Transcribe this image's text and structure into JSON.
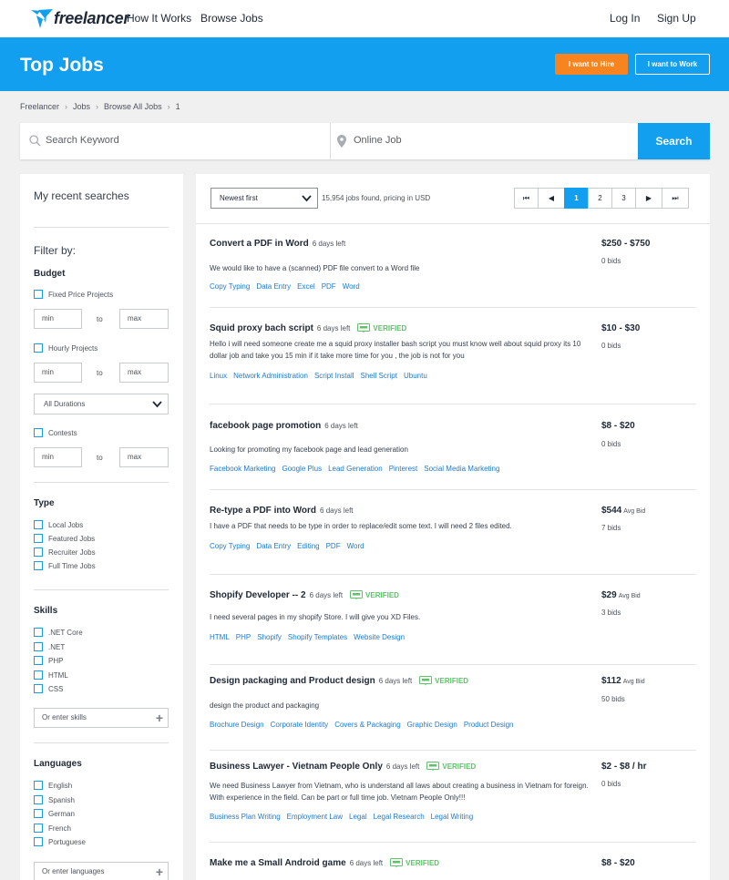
{
  "nav": {
    "logo_text": "freelancer",
    "links": [
      "How It Works",
      "Browse Jobs"
    ],
    "login": "Log In",
    "signup": "Sign Up"
  },
  "hero": {
    "title": "Top Jobs",
    "hire_button": "I want to Hire",
    "work_button": "I want to Work"
  },
  "breadcrumb": [
    "Freelancer",
    "Jobs",
    "Browse All Jobs",
    "1"
  ],
  "search": {
    "keyword_placeholder": "Search Keyword",
    "location_value": "Online Job",
    "button": "Search"
  },
  "sidebar": {
    "recent_searches": "My recent searches",
    "filter_by": "Filter by:",
    "budget": {
      "label": "Budget",
      "fixed": "Fixed Price Projects",
      "hourly": "Hourly Projects",
      "min": "min",
      "to": "to",
      "max": "max",
      "durations": "All Durations",
      "contests": "Contests"
    },
    "type": {
      "label": "Type",
      "items": [
        "Local Jobs",
        "Featured Jobs",
        "Recruiter Jobs",
        "Full Time Jobs"
      ]
    },
    "skills": {
      "label": "Skills",
      "items": [
        ".NET Core",
        ".NET",
        "PHP",
        "HTML",
        "CSS"
      ],
      "enter": "Or enter skills"
    },
    "languages": {
      "label": "Languages",
      "items": [
        "English",
        "Spanish",
        "German",
        "French",
        "Portuguese"
      ],
      "enter": "Or enter languages"
    }
  },
  "results": {
    "sort": "Newest first",
    "count": "15,954 jobs found, pricing in USD",
    "pages": [
      "1",
      "2",
      "3"
    ],
    "active_page": "1",
    "verified_label": "VERIFIED",
    "jobs": [
      {
        "title": "Convert a PDF in Word",
        "days": "6 days left",
        "verified": false,
        "desc": "We would like to have a (scanned) PDF file convert to a Word file",
        "skills": [
          "Copy Typing",
          "Data Entry",
          "Excel",
          "PDF",
          "Word"
        ],
        "price": "$250 - $750",
        "price_note": "",
        "bids": "0 bids"
      },
      {
        "title": "Squid proxy bach script",
        "days": "6 days left",
        "verified": true,
        "desc": "Hello i will need someone create me a squid proxy installer bash script you must know well about squid proxy its 10 dollar job and take you 15 min if it take more time for you , the job is not for you",
        "skills": [
          "Linux",
          "Network Administration",
          "Script Install",
          "Shell Script",
          "Ubuntu"
        ],
        "price": "$10 - $30",
        "price_note": "",
        "bids": "0 bids"
      },
      {
        "title": "facebook page promotion",
        "days": "6 days left",
        "verified": false,
        "desc": "Looking for promoting my facebook page and lead generation",
        "skills": [
          "Facebook Marketing",
          "Google Plus",
          "Lead Generation",
          "Pinterest",
          "Social Media Marketing"
        ],
        "price": "$8 - $20",
        "price_note": "",
        "bids": "0 bids"
      },
      {
        "title": "Re-type a PDF into Word",
        "days": "6 days left",
        "verified": false,
        "desc": "I have a PDF that needs to be type in order to replace/edit some text. I will need 2 files edited.",
        "skills": [
          "Copy Typing",
          "Data Entry",
          "Editing",
          "PDF",
          "Word"
        ],
        "price": "$544",
        "price_note": "Avg Bid",
        "bids": "7 bids"
      },
      {
        "title": "Shopify Developer -- 2",
        "days": "6 days left",
        "verified": true,
        "desc": "I need several pages in my shopify Store. I will give you XD Files.",
        "skills": [
          "HTML",
          "PHP",
          "Shopify",
          "Shopify Templates",
          "Website Design"
        ],
        "price": "$29",
        "price_note": "Avg Bid",
        "bids": "3 bids"
      },
      {
        "title": "Design packaging and Product design",
        "days": "6 days left",
        "verified": true,
        "desc": "design the product and packaging",
        "skills": [
          "Brochure Design",
          "Corporate Identity",
          "Covers & Packaging",
          "Graphic Design",
          "Product Design"
        ],
        "price": "$112",
        "price_note": "Avg Bid",
        "bids": "50 bids"
      },
      {
        "title": "Business Lawyer - Vietnam People Only",
        "days": "6 days left",
        "verified": true,
        "desc": "We need Business Lawyer from Vietnam, who is understand all laws about creating a business in Vietnam for foreign. With experience in the field. Can be part or full time job. Vietnam People Only!!!",
        "skills": [
          "Business Plan Writing",
          "Employment Law",
          "Legal",
          "Legal Research",
          "Legal Writing"
        ],
        "price": "$2 - $8 / hr",
        "price_note": "",
        "bids": "0 bids"
      },
      {
        "title": "Make me a Small Android game",
        "days": "6 days left",
        "verified": true,
        "desc": "",
        "skills": [],
        "price": "$8 - $20",
        "price_note": "",
        "bids": ""
      }
    ]
  },
  "colors": {
    "brand_blue": "#139ff0",
    "hire_orange": "#f7841f",
    "link_blue": "#1c7ad1",
    "verified_green": "#5dc26a"
  }
}
